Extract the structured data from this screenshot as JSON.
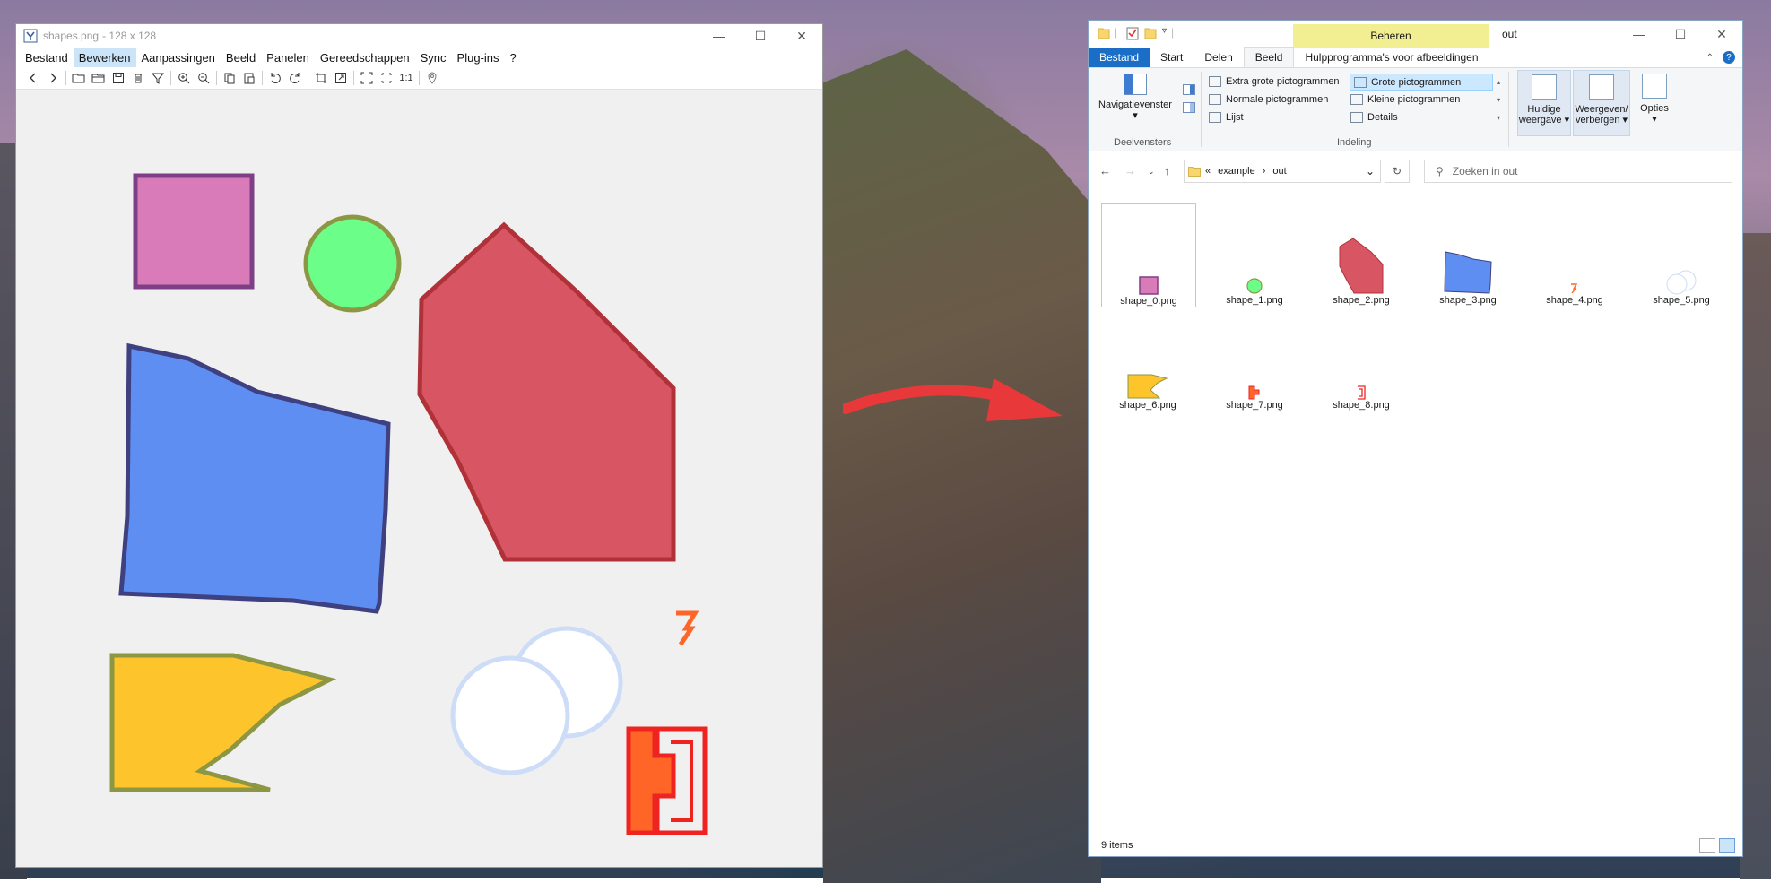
{
  "viewer": {
    "title": "shapes.png",
    "dims": " - 128 x 128",
    "menu": [
      "Bestand",
      "Bewerken",
      "Aanpassingen",
      "Beeld",
      "Panelen",
      "Gereedschappen",
      "Sync",
      "Plug-ins",
      "?"
    ],
    "active_menu": "Bewerken",
    "toolbar_icons": [
      "back-icon",
      "forward-icon",
      "open-icon",
      "folder-icon",
      "save-icon",
      "delete-icon",
      "filter-icon",
      "zoom-in-icon",
      "zoom-out-icon",
      "copy-icon",
      "paste-icon",
      "rotate-left-icon",
      "rotate-right-icon",
      "crop-icon",
      "resize-icon",
      "fullscreen-icon",
      "fit-icon",
      "actual-size-icon",
      "location-icon"
    ],
    "actual_size_text": "1:1"
  },
  "explorer": {
    "context_tab": "Beheren",
    "title": "out",
    "tabs": [
      "Bestand",
      "Start",
      "Delen",
      "Beeld",
      "Hulpprogramma's voor afbeeldingen"
    ],
    "active_tab": "Beeld",
    "ribbon": {
      "nav_pane": "Navigatievenster",
      "panes_group": "Deelvensters",
      "layout_items": [
        "Extra grote pictogrammen",
        "Grote pictogrammen",
        "Normale pictogrammen",
        "Kleine pictogrammen",
        "Lijst",
        "Details"
      ],
      "selected_layout": "Grote pictogrammen",
      "layout_group": "Indeling",
      "current_view": "Huidige weergave",
      "show_hide": "Weergeven/ verbergen",
      "options": "Opties"
    },
    "breadcrumb": [
      "«",
      "example",
      "›",
      "out"
    ],
    "search_placeholder": "Zoeken in out",
    "files": [
      "shape_0.png",
      "shape_1.png",
      "shape_2.png",
      "shape_3.png",
      "shape_4.png",
      "shape_5.png",
      "shape_6.png",
      "shape_7.png",
      "shape_8.png"
    ],
    "status": "9 items"
  },
  "colors": {
    "purple": "#d87bb8",
    "green": "#6bff8a",
    "red": "#d85663",
    "blue": "#5e8ef2",
    "yellow": "#fdc42c",
    "orange": "#ff6527",
    "bright_red": "#ef2420",
    "arrow": "#e8383a",
    "accent": "#1a6ec6"
  }
}
